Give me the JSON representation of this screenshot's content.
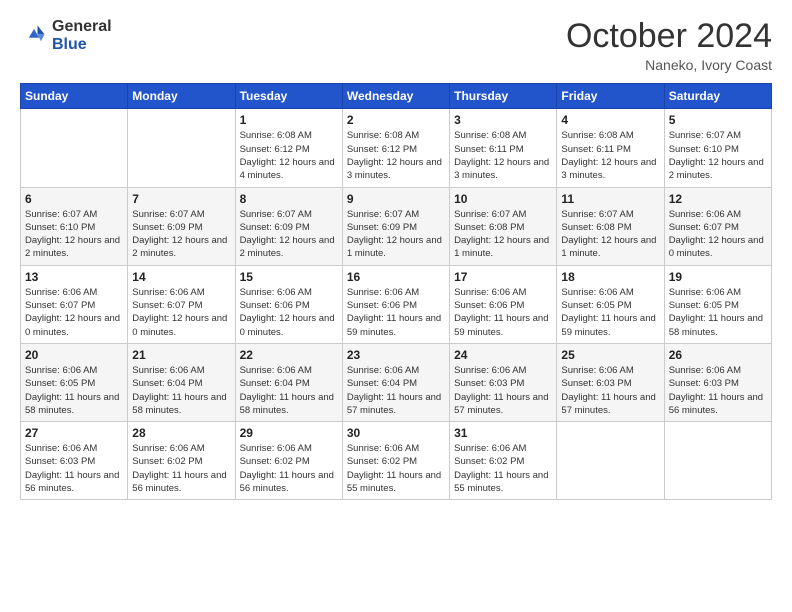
{
  "logo": {
    "general": "General",
    "blue": "Blue"
  },
  "header": {
    "month": "October 2024",
    "location": "Naneko, Ivory Coast"
  },
  "days_of_week": [
    "Sunday",
    "Monday",
    "Tuesday",
    "Wednesday",
    "Thursday",
    "Friday",
    "Saturday"
  ],
  "weeks": [
    [
      {
        "day": "",
        "info": ""
      },
      {
        "day": "",
        "info": ""
      },
      {
        "day": "1",
        "info": "Sunrise: 6:08 AM\nSunset: 6:12 PM\nDaylight: 12 hours and 4 minutes."
      },
      {
        "day": "2",
        "info": "Sunrise: 6:08 AM\nSunset: 6:12 PM\nDaylight: 12 hours and 3 minutes."
      },
      {
        "day": "3",
        "info": "Sunrise: 6:08 AM\nSunset: 6:11 PM\nDaylight: 12 hours and 3 minutes."
      },
      {
        "day": "4",
        "info": "Sunrise: 6:08 AM\nSunset: 6:11 PM\nDaylight: 12 hours and 3 minutes."
      },
      {
        "day": "5",
        "info": "Sunrise: 6:07 AM\nSunset: 6:10 PM\nDaylight: 12 hours and 2 minutes."
      }
    ],
    [
      {
        "day": "6",
        "info": "Sunrise: 6:07 AM\nSunset: 6:10 PM\nDaylight: 12 hours and 2 minutes."
      },
      {
        "day": "7",
        "info": "Sunrise: 6:07 AM\nSunset: 6:09 PM\nDaylight: 12 hours and 2 minutes."
      },
      {
        "day": "8",
        "info": "Sunrise: 6:07 AM\nSunset: 6:09 PM\nDaylight: 12 hours and 2 minutes."
      },
      {
        "day": "9",
        "info": "Sunrise: 6:07 AM\nSunset: 6:09 PM\nDaylight: 12 hours and 1 minute."
      },
      {
        "day": "10",
        "info": "Sunrise: 6:07 AM\nSunset: 6:08 PM\nDaylight: 12 hours and 1 minute."
      },
      {
        "day": "11",
        "info": "Sunrise: 6:07 AM\nSunset: 6:08 PM\nDaylight: 12 hours and 1 minute."
      },
      {
        "day": "12",
        "info": "Sunrise: 6:06 AM\nSunset: 6:07 PM\nDaylight: 12 hours and 0 minutes."
      }
    ],
    [
      {
        "day": "13",
        "info": "Sunrise: 6:06 AM\nSunset: 6:07 PM\nDaylight: 12 hours and 0 minutes."
      },
      {
        "day": "14",
        "info": "Sunrise: 6:06 AM\nSunset: 6:07 PM\nDaylight: 12 hours and 0 minutes."
      },
      {
        "day": "15",
        "info": "Sunrise: 6:06 AM\nSunset: 6:06 PM\nDaylight: 12 hours and 0 minutes."
      },
      {
        "day": "16",
        "info": "Sunrise: 6:06 AM\nSunset: 6:06 PM\nDaylight: 11 hours and 59 minutes."
      },
      {
        "day": "17",
        "info": "Sunrise: 6:06 AM\nSunset: 6:06 PM\nDaylight: 11 hours and 59 minutes."
      },
      {
        "day": "18",
        "info": "Sunrise: 6:06 AM\nSunset: 6:05 PM\nDaylight: 11 hours and 59 minutes."
      },
      {
        "day": "19",
        "info": "Sunrise: 6:06 AM\nSunset: 6:05 PM\nDaylight: 11 hours and 58 minutes."
      }
    ],
    [
      {
        "day": "20",
        "info": "Sunrise: 6:06 AM\nSunset: 6:05 PM\nDaylight: 11 hours and 58 minutes."
      },
      {
        "day": "21",
        "info": "Sunrise: 6:06 AM\nSunset: 6:04 PM\nDaylight: 11 hours and 58 minutes."
      },
      {
        "day": "22",
        "info": "Sunrise: 6:06 AM\nSunset: 6:04 PM\nDaylight: 11 hours and 58 minutes."
      },
      {
        "day": "23",
        "info": "Sunrise: 6:06 AM\nSunset: 6:04 PM\nDaylight: 11 hours and 57 minutes."
      },
      {
        "day": "24",
        "info": "Sunrise: 6:06 AM\nSunset: 6:03 PM\nDaylight: 11 hours and 57 minutes."
      },
      {
        "day": "25",
        "info": "Sunrise: 6:06 AM\nSunset: 6:03 PM\nDaylight: 11 hours and 57 minutes."
      },
      {
        "day": "26",
        "info": "Sunrise: 6:06 AM\nSunset: 6:03 PM\nDaylight: 11 hours and 56 minutes."
      }
    ],
    [
      {
        "day": "27",
        "info": "Sunrise: 6:06 AM\nSunset: 6:03 PM\nDaylight: 11 hours and 56 minutes."
      },
      {
        "day": "28",
        "info": "Sunrise: 6:06 AM\nSunset: 6:02 PM\nDaylight: 11 hours and 56 minutes."
      },
      {
        "day": "29",
        "info": "Sunrise: 6:06 AM\nSunset: 6:02 PM\nDaylight: 11 hours and 56 minutes."
      },
      {
        "day": "30",
        "info": "Sunrise: 6:06 AM\nSunset: 6:02 PM\nDaylight: 11 hours and 55 minutes."
      },
      {
        "day": "31",
        "info": "Sunrise: 6:06 AM\nSunset: 6:02 PM\nDaylight: 11 hours and 55 minutes."
      },
      {
        "day": "",
        "info": ""
      },
      {
        "day": "",
        "info": ""
      }
    ]
  ]
}
